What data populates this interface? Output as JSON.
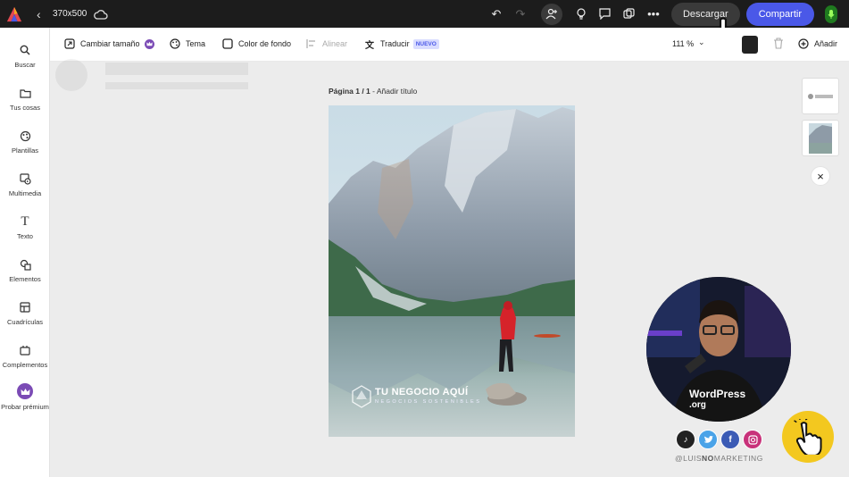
{
  "topbar": {
    "doc_size": "370x500",
    "download_label": "Descargar",
    "share_label": "Compartir",
    "colors": {
      "bar_bg": "#1c1c1c",
      "share_bg": "#4a58e8",
      "download_bg": "#3a3a3a"
    }
  },
  "sidebar": {
    "items": [
      {
        "label": "Buscar",
        "icon": "search-icon"
      },
      {
        "label": "Tus cosas",
        "icon": "folder-icon"
      },
      {
        "label": "Plantillas",
        "icon": "templates-icon"
      },
      {
        "label": "Multimedia",
        "icon": "media-icon"
      },
      {
        "label": "Texto",
        "icon": "text-icon"
      },
      {
        "label": "Elementos",
        "icon": "shapes-icon"
      },
      {
        "label": "Cuadrículas",
        "icon": "grid-icon"
      },
      {
        "label": "Complementos",
        "icon": "addons-icon"
      },
      {
        "label": "Probar prémium",
        "icon": "crown-icon"
      }
    ]
  },
  "toolbar": {
    "resize": "Cambiar tamaño",
    "theme": "Tema",
    "bg_color": "Color de fondo",
    "align": "Alinear",
    "translate": "Traducir",
    "new_badge": "NUEVO",
    "zoom": "111 %",
    "add": "Añadir"
  },
  "canvas": {
    "page_number": "Página 1 / 1",
    "add_title": " - Añadir título",
    "brand_name": "TU NEGOCIO AQUÍ",
    "brand_tagline": "NEGOCIOS SOSTENIBLES"
  },
  "overlay": {
    "shirt_line1": "WordPress",
    "shirt_line2": ".org",
    "handle_prefix": "@LUIS",
    "handle_mid": "NO",
    "handle_suffix": "MARKETING",
    "social_icons": [
      "tiktok-icon",
      "twitter-icon",
      "facebook-icon",
      "instagram-icon"
    ]
  }
}
